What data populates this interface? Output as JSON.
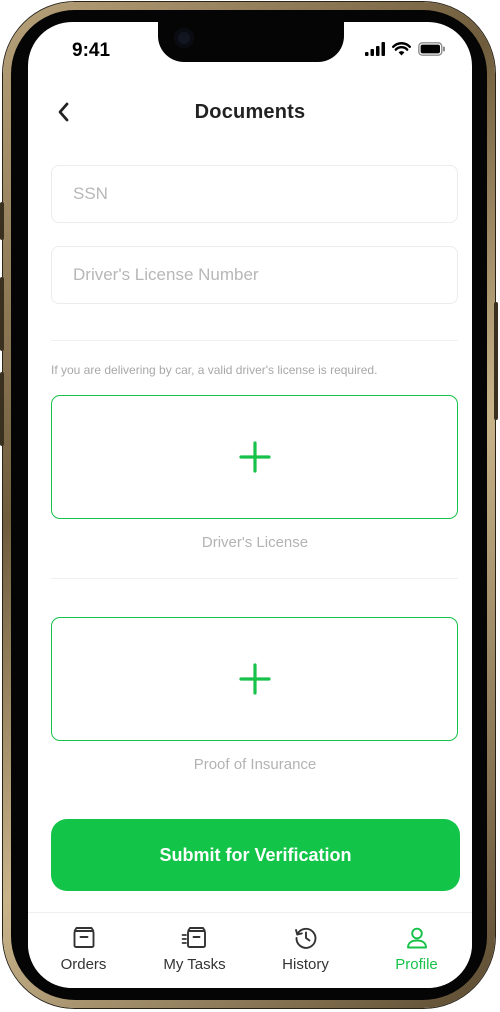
{
  "status": {
    "time": "9:41"
  },
  "header": {
    "title": "Documents",
    "back_icon": "chevron-left-icon"
  },
  "form": {
    "ssn": {
      "placeholder": "SSN",
      "value": ""
    },
    "license_number": {
      "placeholder": "Driver's License Number",
      "value": ""
    },
    "hint": "If you are delivering by car, a valid driver's license is required."
  },
  "uploads": [
    {
      "label": "Driver's License",
      "icon": "plus-icon"
    },
    {
      "label": "Proof of Insurance",
      "icon": "plus-icon"
    }
  ],
  "submit_label": "Submit for Verification",
  "tabs": [
    {
      "label": "Orders",
      "icon": "orders-icon",
      "active": false
    },
    {
      "label": "My Tasks",
      "icon": "tasks-icon",
      "active": false
    },
    {
      "label": "History",
      "icon": "history-icon",
      "active": false
    },
    {
      "label": "Profile",
      "icon": "profile-icon",
      "active": true
    }
  ],
  "colors": {
    "accent": "#12c548",
    "text": "#222222",
    "muted": "#b3b3b3"
  }
}
